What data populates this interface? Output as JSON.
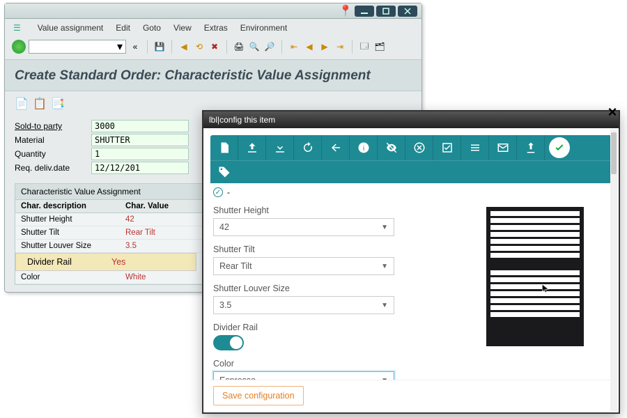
{
  "sap": {
    "menu": [
      "Value assignment",
      "Edit",
      "Goto",
      "View",
      "Extras",
      "Environment"
    ],
    "page_title": "Create Standard Order: Characteristic Value Assignment",
    "fields": {
      "sold_to_label": "Sold-to party",
      "sold_to": "3000",
      "material_label": "Material",
      "material": "SHUTTER",
      "quantity_label": "Quantity",
      "quantity": "1",
      "reqdate_label": "Req. deliv.date",
      "reqdate": "12/12/201"
    },
    "section_title": "Characteristic Value Assignment",
    "cols": {
      "c1": "Char. description",
      "c2": "Char. Value"
    },
    "rows": [
      {
        "d": "Shutter Height",
        "v": "42"
      },
      {
        "d": "Shutter Tilt",
        "v": "Rear Tilt"
      },
      {
        "d": "Shutter Louver Size",
        "v": "3.5"
      },
      {
        "d": "Divider Rail",
        "v": "Yes",
        "sel": true
      },
      {
        "d": "Color",
        "v": "White"
      }
    ]
  },
  "cfg": {
    "title": "lbl|config this item",
    "status_dash": "-",
    "fields": {
      "height_label": "Shutter Height",
      "height": "42",
      "tilt_label": "Shutter Tilt",
      "tilt": "Rear Tilt",
      "louver_label": "Shutter Louver Size",
      "louver": "3.5",
      "divider_label": "Divider Rail",
      "divider_on": true,
      "color_label": "Color",
      "color": "Espresso"
    },
    "save_label": "Save configuration"
  }
}
